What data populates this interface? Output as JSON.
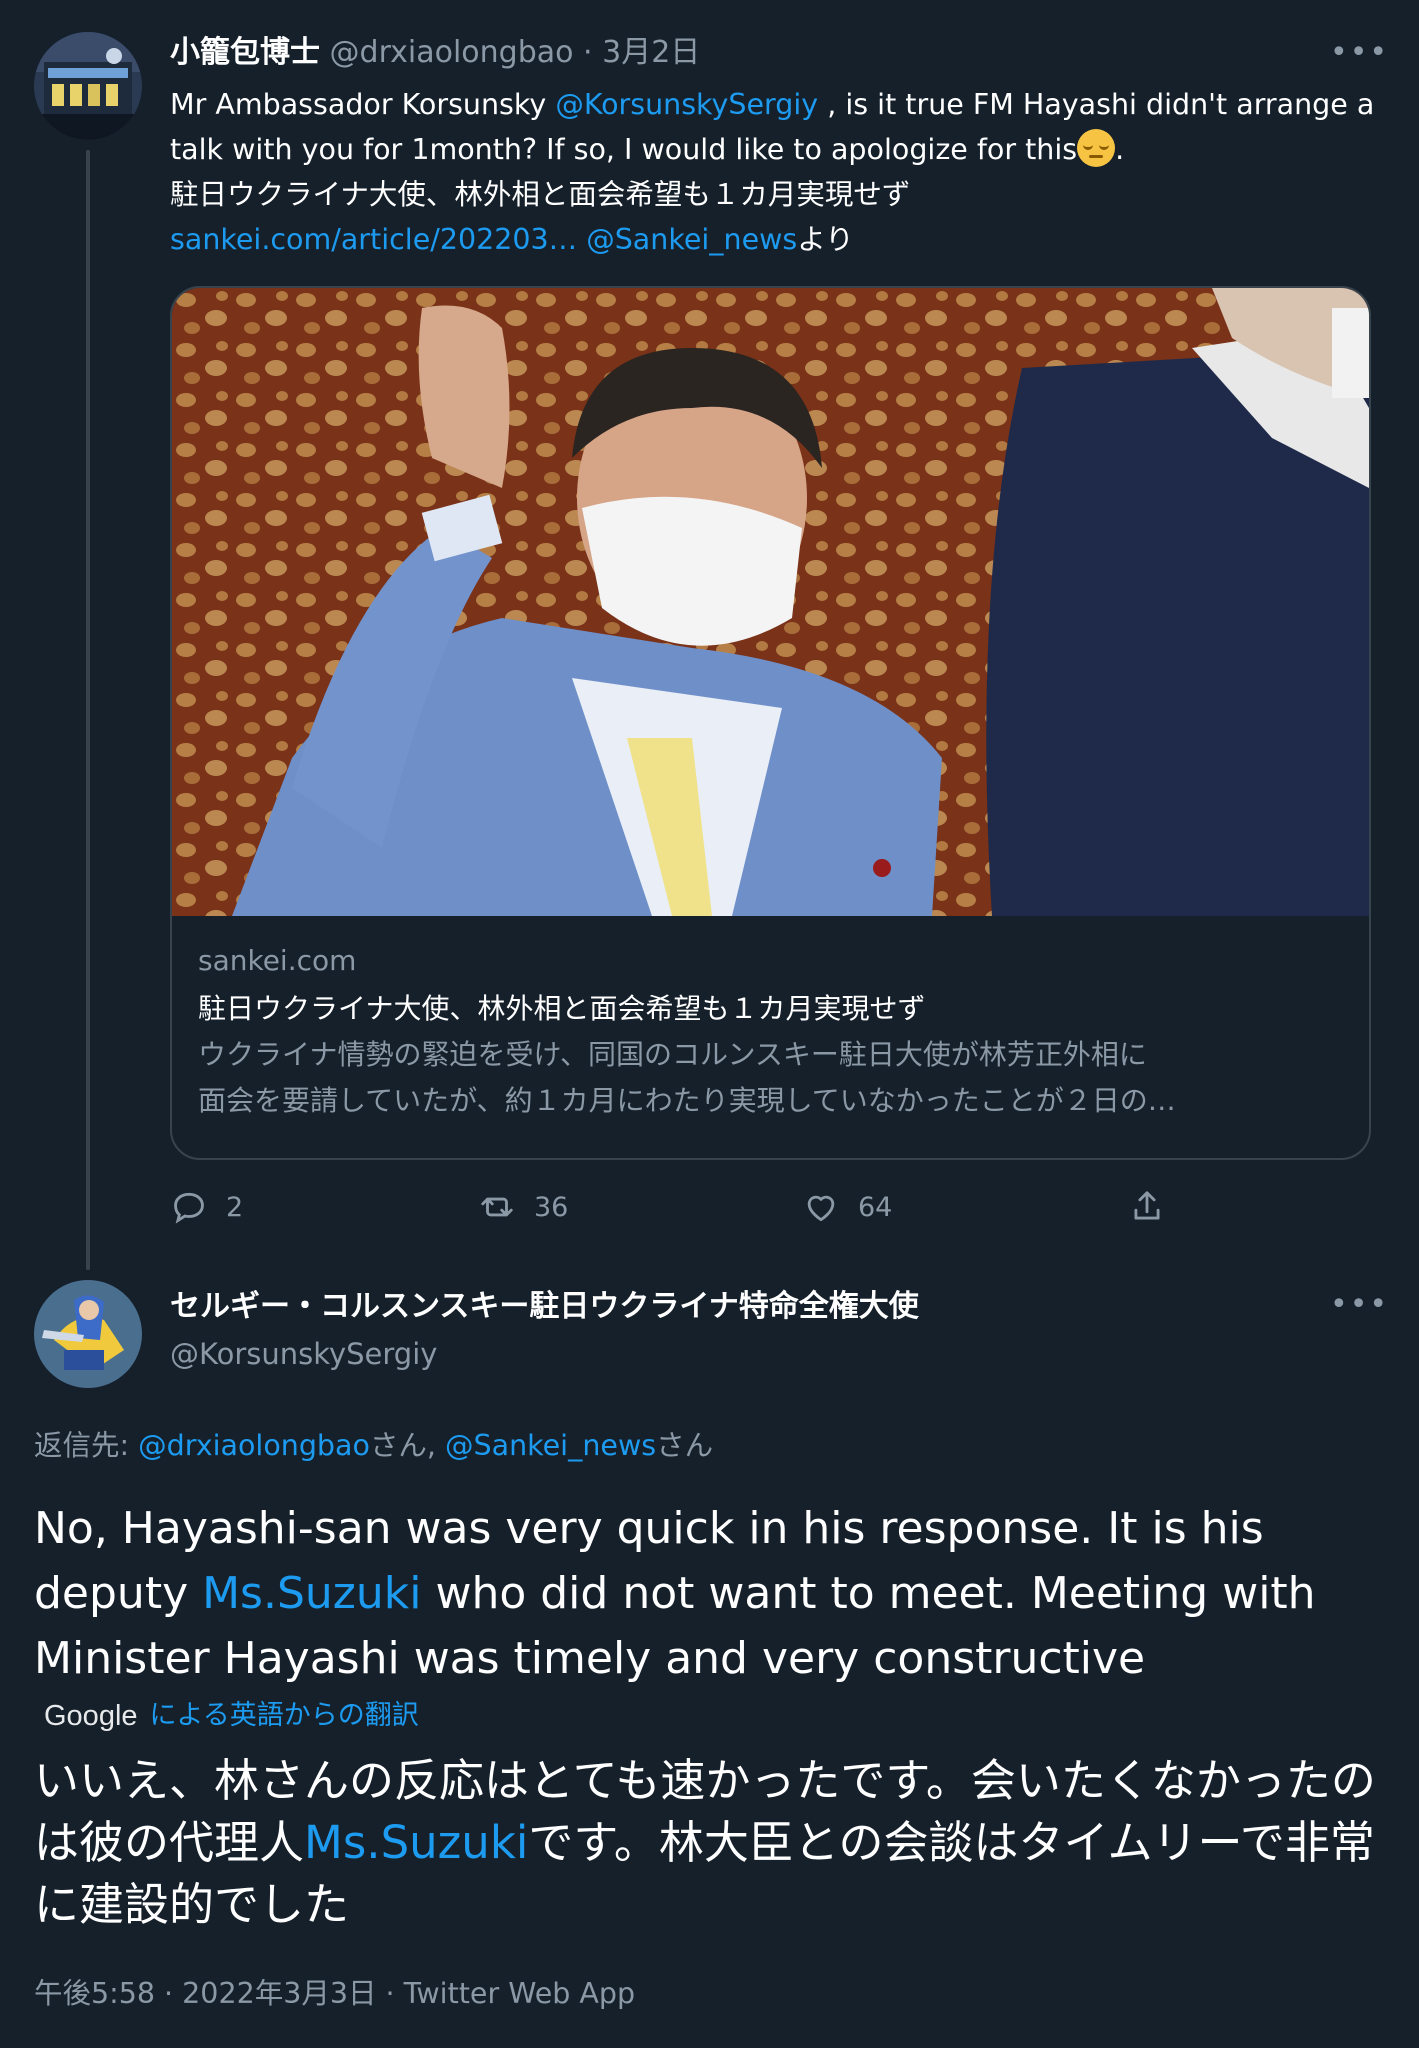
{
  "tweet1": {
    "display_name": "小籠包博士",
    "handle": "@drxiaolongbao",
    "separator": "·",
    "date": "3月2日",
    "more_label": "•••",
    "text_part1": "Mr Ambassador Korsunsky ",
    "mention": "@KorsunskySergiy",
    "text_part2": " , is it true FM Hayashi didn't arrange a talk with you for 1month? If so, I would like to apologize for this",
    "emoji_name": "pensive-face-emoji",
    "text_part3": ".",
    "text_line3": "駐日ウクライナ大使、林外相と面会希望も１カ月実現せず",
    "link_text": "sankei.com/article/202203…",
    "link_space": " ",
    "link_mention": "@Sankei_news",
    "link_suffix": "より",
    "card": {
      "domain": "sankei.com",
      "title": "駐日ウクライナ大使、林外相と面会希望も１カ月実現せず",
      "desc_line1": "ウクライナ情勢の緊迫を受け、同国のコルンスキー駐日大使が林芳正外相に",
      "desc_line2": "面会を要請していたが、約１カ月にわたり実現していなかったことが２日の…"
    },
    "actions": {
      "replies": "2",
      "retweets": "36",
      "likes": "64"
    }
  },
  "tweet2": {
    "display_name": "セルギー・コルスンスキー駐日ウクライナ特命全権大使",
    "handle": "@KorsunskySergiy",
    "more_label": "•••",
    "replying_to_label": "返信先: ",
    "reply_mention1": "@drxiaolongbao",
    "reply_san1": "さん, ",
    "reply_mention2": "@Sankei_news",
    "reply_san2": "さん",
    "text_part1": "No, Hayashi-san was very quick in his response. It is his deputy ",
    "text_mention": "Ms.Suzuki",
    "text_part2": " who did not want to meet. Meeting with Minister Hayashi was timely and very constructive",
    "google_label": "Google",
    "translated_by": "による英語からの翻訳",
    "translated_part1": "いいえ、林さんの反応はとても速かったです。会いたくなかったのは彼の代理人",
    "translated_mention": "Ms.Suzuki",
    "translated_part2": "です。林大臣との会談はタイムリーで非常に建設的でした",
    "meta": "午後5:58 · 2022年3月3日 · Twitter Web App"
  },
  "colors": {
    "background": "#15202b",
    "link": "#1d9bf0",
    "muted": "#8b98a5",
    "border": "#38444d"
  }
}
